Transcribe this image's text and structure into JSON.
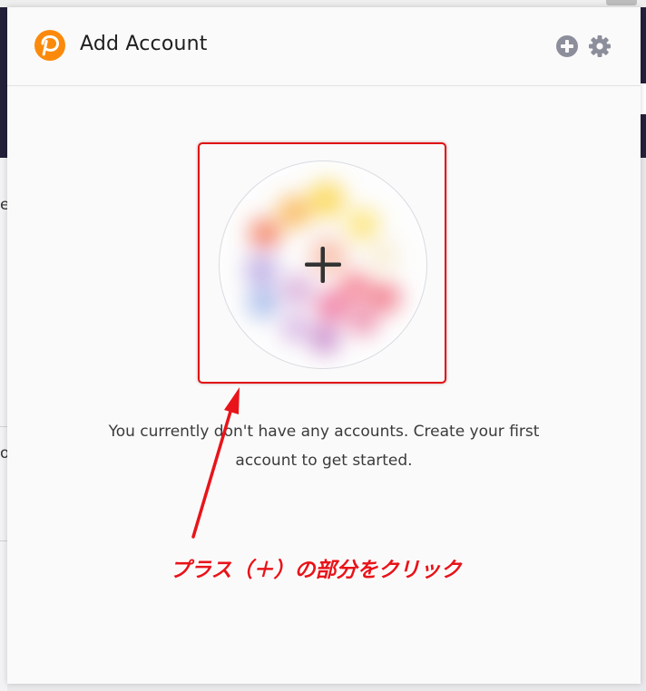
{
  "header": {
    "title": "Add Account",
    "logo_icon": "polkadot-logo-icon",
    "add_icon": "plus-circle-icon",
    "settings_icon": "gear-icon"
  },
  "main": {
    "create_account_icon": "plus-icon",
    "empty_message": "You currently don't have any accounts. Create your first account to get started."
  },
  "annotation": {
    "label": "プラス（＋）の部分をクリック",
    "color": "#e8141a"
  },
  "background_page": {
    "fragments": [
      "e",
      "o"
    ]
  },
  "colors": {
    "brand": "#fb8a0c",
    "header_icons": "#8d8e9b",
    "annotation": "#e8141a"
  }
}
